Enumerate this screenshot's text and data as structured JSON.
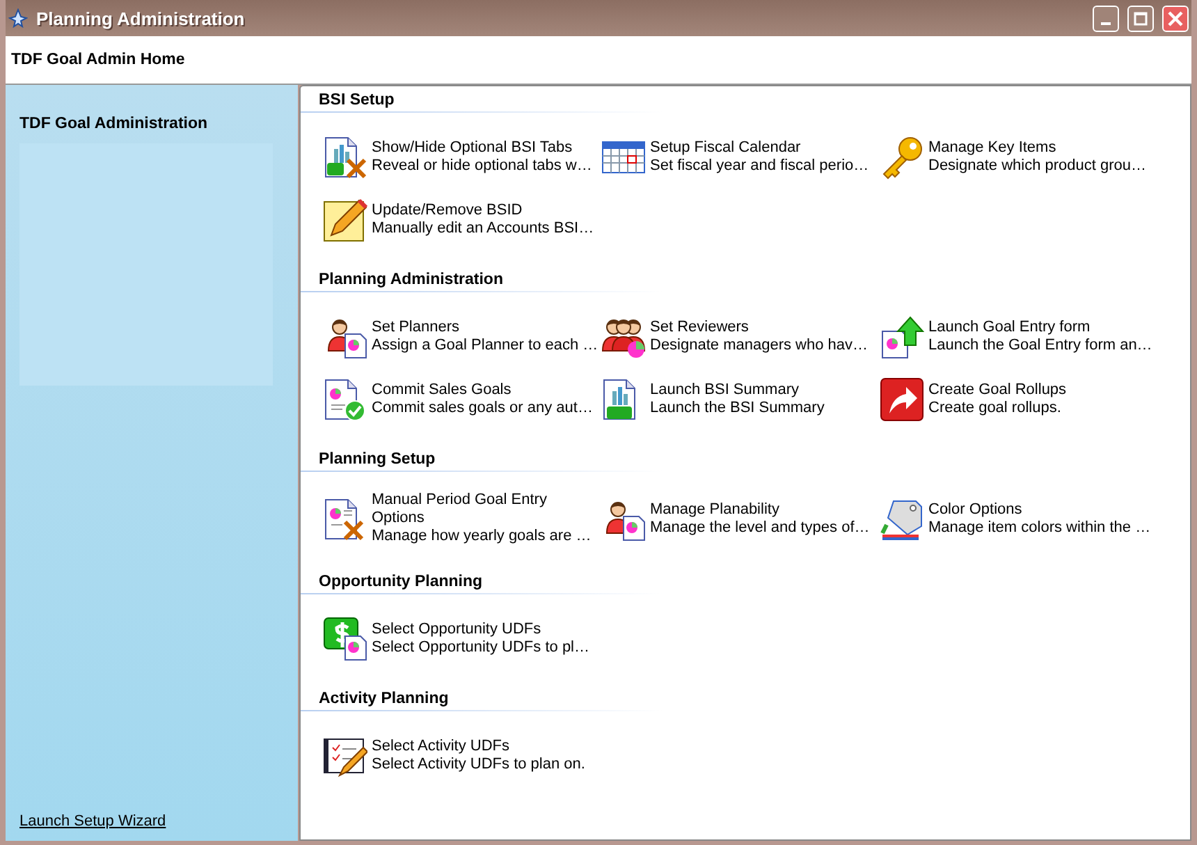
{
  "window": {
    "title": "Planning Administration"
  },
  "header": {
    "title": "TDF Goal Admin Home"
  },
  "sidebar": {
    "title": "TDF Goal Administration",
    "link": "Launch Setup Wizard"
  },
  "sections": [
    {
      "title": "BSI Setup",
      "items": [
        {
          "title": "Show/Hide Optional BSI Tabs",
          "description": "Reveal or hide optional tabs w…"
        },
        {
          "title": "Setup Fiscal Calendar",
          "description": "Set fiscal year and fiscal perio…"
        },
        {
          "title": "Manage Key Items",
          "description": "Designate which product grou…"
        },
        {
          "title": "Update/Remove BSID",
          "description": "Manually edit an Accounts BSI…"
        }
      ]
    },
    {
      "title": "Planning Administration",
      "items": [
        {
          "title": "Set Planners",
          "description": "Assign a Goal Planner to each …"
        },
        {
          "title": "Set Reviewers",
          "description": "Designate managers who hav…"
        },
        {
          "title": "Launch Goal Entry form",
          "description": "Launch the Goal Entry form an…"
        },
        {
          "title": "Commit Sales Goals",
          "description": "Commit sales goals or any aut…"
        },
        {
          "title": "Launch BSI Summary",
          "description": "Launch the BSI Summary"
        },
        {
          "title": "Create Goal Rollups",
          "description": "Create goal rollups."
        }
      ]
    },
    {
      "title": "Planning Setup",
      "items": [
        {
          "title": "Manual Period Goal Entry Options",
          "description": "Manage how yearly goals are …"
        },
        {
          "title": "Manage Planability",
          "description": "Manage the level and types of…"
        },
        {
          "title": "Color Options",
          "description": "Manage item colors within the …"
        }
      ]
    },
    {
      "title": "Opportunity Planning",
      "items": [
        {
          "title": "Select Opportunity UDFs",
          "description": "Select Opportunity UDFs to pl…"
        }
      ]
    },
    {
      "title": "Activity Planning",
      "items": [
        {
          "title": "Select Activity UDFs",
          "description": "Select Activity UDFs to plan on."
        }
      ]
    }
  ]
}
